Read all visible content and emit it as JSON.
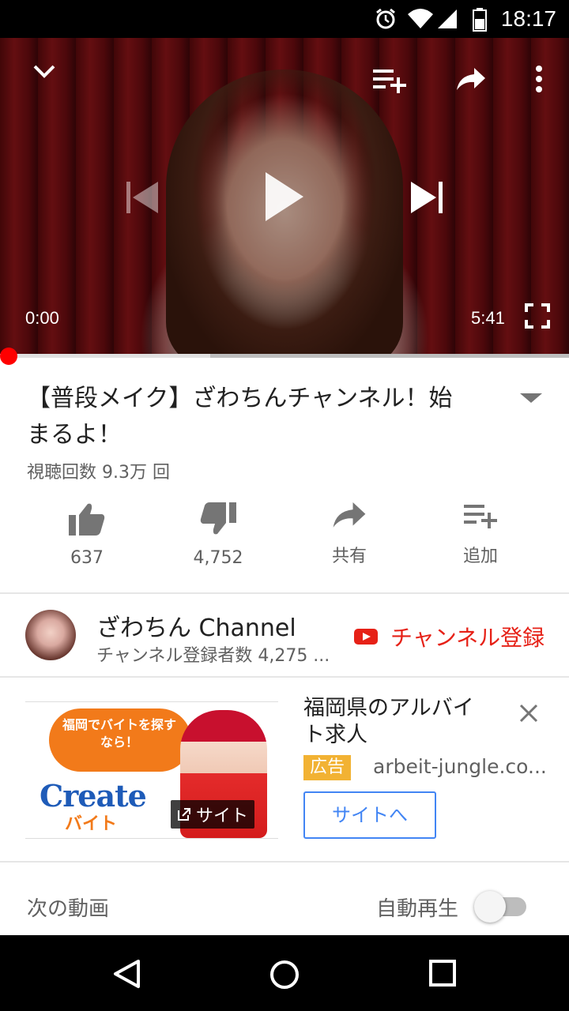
{
  "status_bar": {
    "time": "18:17"
  },
  "player": {
    "current_time": "0:00",
    "duration": "5:41",
    "progress_fraction": 0.0,
    "buffered_fraction": 0.37
  },
  "video": {
    "title": "【普段メイク】ざわちん チャンネル！始まるよ！",
    "title_line1": "【普段メイク】ざわちんチャンネル！始",
    "title_line2": "まるよ！",
    "views": "視聴回数 9.3万 回"
  },
  "actions": [
    {
      "label": "637",
      "icon": "thumbs-up-icon"
    },
    {
      "label": "4,752",
      "icon": "thumbs-down-icon"
    },
    {
      "label": "共有",
      "icon": "share-icon"
    },
    {
      "label": "追加",
      "icon": "add-to-playlist-icon"
    }
  ],
  "channel": {
    "name": "ざわちん Channel",
    "subscribers": "チャンネル登録者数 4,275 ...",
    "subscribe_label": "チャンネル登録"
  },
  "ad": {
    "thumb_cloud_text": "福岡でバイトを探すなら！",
    "thumb_logo": "Create",
    "thumb_sub": "バイト",
    "site_badge": "サイト",
    "title": "福岡県のアルバイト求人",
    "badge": "広告",
    "domain": "arbeit-jungle.co...",
    "button": "サイトへ"
  },
  "up_next": {
    "label": "次の動画",
    "autoplay_label": "自動再生",
    "autoplay_on": false
  },
  "colors": {
    "accent_red": "#e62117",
    "ad_blue": "#4285f4",
    "ad_badge": "#f2b233"
  }
}
